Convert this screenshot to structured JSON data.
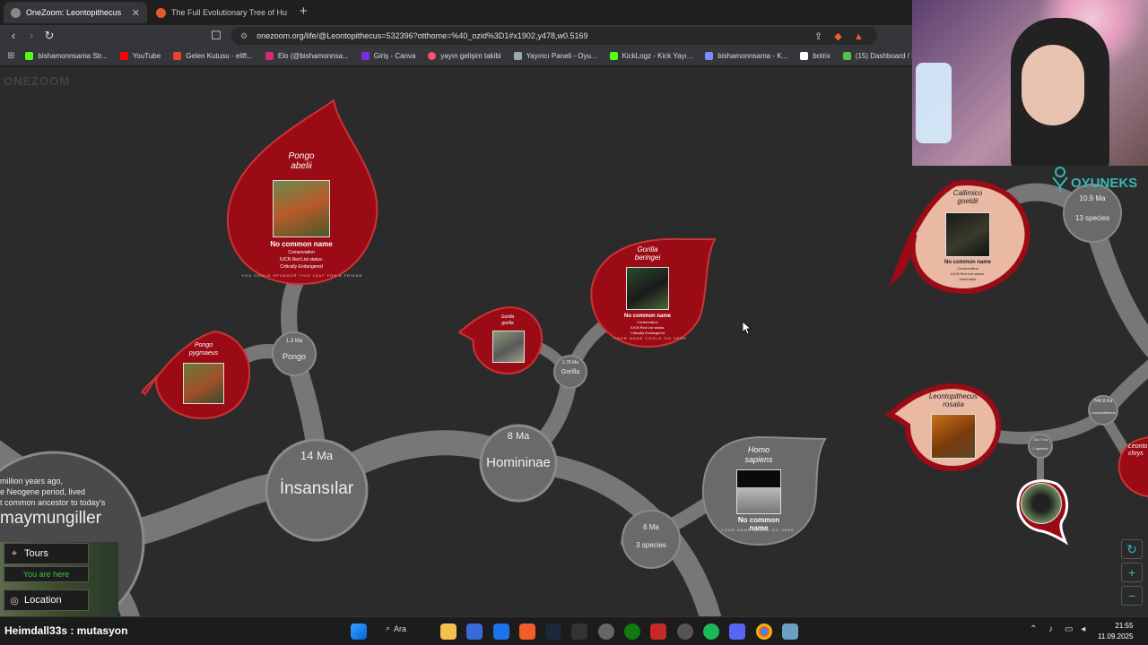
{
  "browser": {
    "tabs": [
      {
        "title": "OneZoom: Leontopithecus",
        "active": true
      },
      {
        "title": "The Full Evolutionary Tree of Human",
        "active": false
      }
    ],
    "url": "onezoom.org/life/@Leontopithecus=532396?otthome=%40_ozid%3D1#x1902,y478,w0.5169",
    "bookmarks": [
      "bishamonnsama Str...",
      "YouTube",
      "Gelen Kutusu - elift...",
      "Elo (@bishamonnsa...",
      "Giriş - Canva",
      "yayın gelişim takibi",
      "Yayıncı Paneli - Oyu...",
      "KickLogz - Kick Yayı...",
      "bishamonnsama - K...",
      "botrix",
      "(15) Dashboard / Str..."
    ]
  },
  "tree": {
    "logo": "ONEZOOM",
    "nodes": {
      "insansilar": {
        "age": "14 Ma",
        "name": "İnsansılar"
      },
      "homininae": {
        "age": "8 Ma",
        "name": "Homininae"
      },
      "pongo": {
        "age": "1.3 Ma",
        "name": "Pongo"
      },
      "gorilla": {
        "age": "1.78 Ma",
        "name": "Gorilla"
      },
      "homo": {
        "age": "6 Ma",
        "name": "3 species"
      },
      "right_top": {
        "age": "10.9 Ma",
        "name": "13 species"
      },
      "leonto": {
        "age": "540.8 Ka",
        "name": "Leontopithecus"
      },
      "small": {
        "age": "130.7 Ka",
        "name": "2 species"
      }
    },
    "intro": {
      "line1": "million years ago,",
      "line2": "e Neogene period, lived",
      "line3": "t common ancestor to today's",
      "title": "maymungiller"
    },
    "leaves": {
      "pongo_abelii": {
        "sci1": "Pongo",
        "sci2": "abelii",
        "common": "No common name",
        "status1": "Conservation",
        "status2": "IUCN Red List status:",
        "status3": "Critically Endangered",
        "sponsor": "YOU COULD SPONSOR THIS LEAF FOR A FRIEND"
      },
      "pongo_pygmaeus": {
        "sci1": "Pongo",
        "sci2": "pygmaeus"
      },
      "gorilla_gorilla": {
        "sci1": "Gorilla",
        "sci2": "gorilla"
      },
      "gorilla_beringei": {
        "sci1": "Gorilla",
        "sci2": "beringei",
        "common": "No common name",
        "status1": "Conservation",
        "status2": "IUCN Red List status:",
        "status3": "Critically Endangered",
        "sponsor": "YOUR NAME COULD GO HERE"
      },
      "homo_sapiens": {
        "sci1": "Homo",
        "sci2": "sapiens",
        "common1": "No common",
        "common2": "name",
        "sponsor": "YOUR NAME COULD GO HERE"
      },
      "callimico": {
        "sci1": "Callimico",
        "sci2": "goeldii",
        "common": "No common name",
        "status1": "Conservation",
        "status2": "IUCN Red List status:",
        "status3": "Vulnerable",
        "sponsor": "YOU COULD SPONSOR THIS LEAF FOR A FRIEND"
      },
      "leonto_rosalia": {
        "sci1": "Leontopithecus",
        "sci2": "rosalia"
      },
      "leonto_chry": {
        "sci1": "Leonto",
        "sci2": "chrys"
      }
    }
  },
  "panel": {
    "tours": "Tours",
    "here": "You are here",
    "location": "Location"
  },
  "overlay": {
    "brand": "OYUNEKS"
  },
  "taskbar": {
    "chat_user": "Heimdall33s",
    "chat_sep": " : ",
    "chat_msg": "mutasyon",
    "search": "Ara",
    "time": "21:55",
    "date": "11.09.2025"
  },
  "colors": {
    "leaf_red": "#9b0b16",
    "leaf_pink": "#e9b9a3",
    "branch": "#777777",
    "node_fill": "#686868",
    "bg": "#2b2b2b"
  }
}
